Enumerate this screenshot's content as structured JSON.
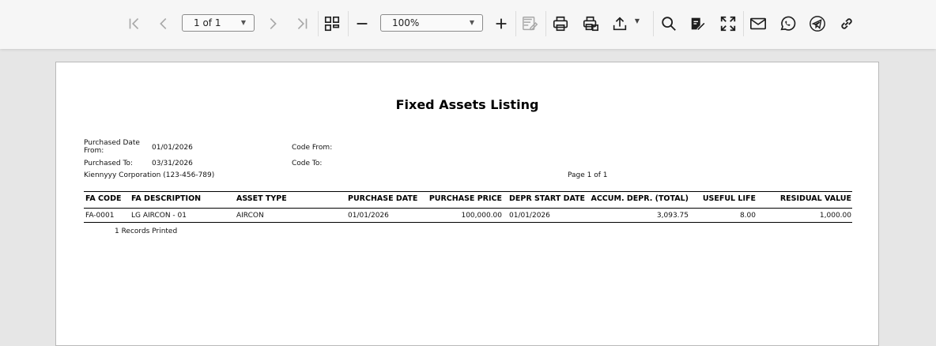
{
  "toolbar": {
    "page_indicator": "1 of 1",
    "zoom_value": "100%",
    "icons": [
      "first-page-icon",
      "previous-page-icon",
      "next-page-icon",
      "last-page-icon",
      "thumbnails-icon",
      "zoom-out-icon",
      "zoom-in-icon",
      "edit-form-icon",
      "print-icon",
      "print-layout-icon",
      "export-icon",
      "search-icon",
      "editing-icon",
      "fullscreen-icon",
      "email-icon",
      "whatsapp-icon",
      "telegram-icon",
      "link-icon"
    ]
  },
  "report": {
    "title": "Fixed Assets Listing",
    "filters": {
      "purchased_date_from_label": "Purchased Date From:",
      "purchased_date_from_value": "01/01/2026",
      "purchased_to_label": "Purchased To:",
      "purchased_to_value": "03/31/2026",
      "code_from_label": "Code From:",
      "code_to_label": "Code To:"
    },
    "company": "Kiennyyy Corporation (123-456-789)",
    "page_info": "Page 1 of 1",
    "columns": [
      "FA CODE",
      "FA DESCRIPTION",
      "ASSET TYPE",
      "PURCHASE DATE",
      "PURCHASE PRICE",
      "DEPR START DATE",
      "ACCUM. DEPR. (TOTAL)",
      "USEFUL LIFE",
      "RESIDUAL VALUE"
    ],
    "rows": [
      {
        "fa_code": "FA-0001",
        "description": "LG AIRCON - 01",
        "asset_type": "AIRCON",
        "purchase_date": "01/01/2026",
        "purchase_price": "100,000.00",
        "depr_start_date": "01/01/2026",
        "accum_depr": "3,093.75",
        "useful_life": "8.00",
        "residual_value": "1,000.00"
      }
    ],
    "records_printed": "1 Records Printed"
  }
}
